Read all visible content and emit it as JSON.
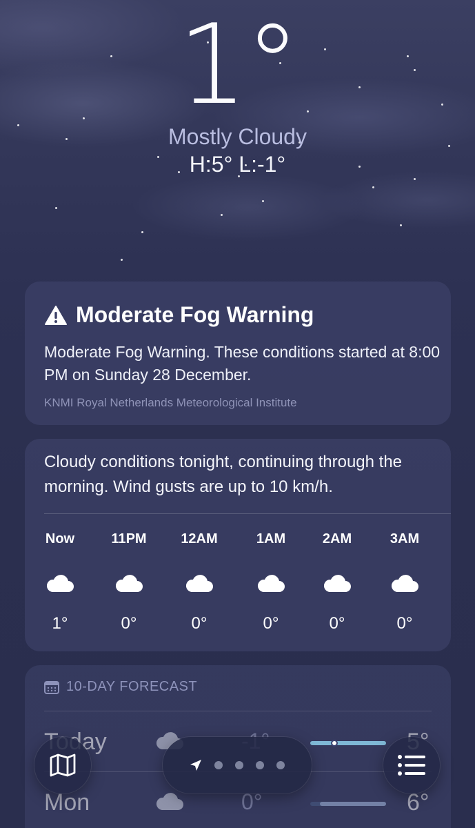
{
  "current": {
    "temperature": "1°",
    "condition": "Mostly Cloudy",
    "high_low": "H:5°  L:-1°"
  },
  "alert": {
    "title": "Moderate Fog Warning",
    "icon": "warning-triangle-icon",
    "body": "Moderate Fog Warning. These conditions started at 8:00 PM on Sunday 28 December.",
    "source": "KNMI Royal Netherlands Meteorological Institute"
  },
  "hourly": {
    "summary": "Cloudy conditions tonight, continuing through the morning. Wind gusts are up to 10 km/h.",
    "hours": [
      {
        "label": "Now",
        "icon": "cloud-icon",
        "temp": "1°"
      },
      {
        "label": "11PM",
        "icon": "cloud-icon",
        "temp": "0°"
      },
      {
        "label": "12AM",
        "icon": "cloud-icon",
        "temp": "0°"
      },
      {
        "label": "1AM",
        "icon": "cloud-icon",
        "temp": "0°"
      },
      {
        "label": "2AM",
        "icon": "cloud-icon",
        "temp": "0°"
      },
      {
        "label": "3AM",
        "icon": "cloud-icon",
        "temp": "0°"
      }
    ]
  },
  "forecast": {
    "header": "10-DAY FORECAST",
    "days": [
      {
        "day": "Today",
        "icon": "cloud-icon",
        "low": "-1°",
        "high": "5°"
      },
      {
        "day": "Mon",
        "icon": "cloud-icon",
        "low": "0°",
        "high": "6°"
      }
    ]
  },
  "toolbar": {
    "map_icon": "map-icon",
    "location_icon": "location-arrow-icon",
    "list_icon": "list-icon",
    "page_count": 5
  },
  "colors": {
    "background": "#2d3153",
    "card": "#464c76",
    "condition_text": "#b9bde0",
    "secondary_text": "#8f93b7",
    "temp_bar": "#7fb8d6"
  }
}
